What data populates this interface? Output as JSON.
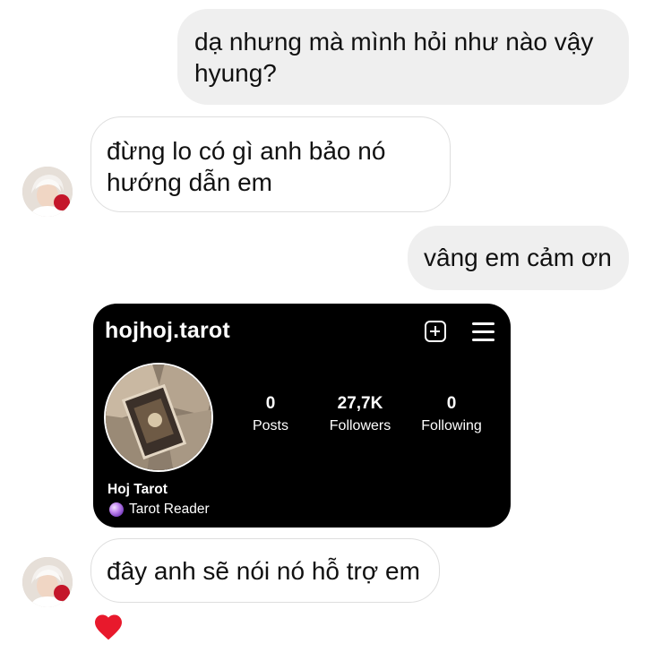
{
  "messages": [
    {
      "direction": "outgoing",
      "lines": [
        "dạ nhưng mà mình hỏi như nào vậy",
        "hyung?"
      ]
    },
    {
      "direction": "incoming",
      "lines": [
        "đừng lo có gì anh bảo nó",
        "hướng dẫn em"
      ]
    },
    {
      "direction": "outgoing",
      "lines": [
        "vâng em cảm ơn"
      ]
    },
    {
      "direction": "incoming",
      "lines": [
        "đây anh sẽ nói nó hỗ trợ em"
      ]
    }
  ],
  "shared_profile": {
    "username": "hojhoj.tarot",
    "stats": [
      {
        "value": "0",
        "label": "Posts"
      },
      {
        "value": "27,7K",
        "label": "Followers"
      },
      {
        "value": "0",
        "label": "Following"
      }
    ],
    "display_name": "Hoj Tarot",
    "bio": "Tarot Reader",
    "bio_icon": "crystal-ball-icon",
    "header_icons": [
      "new-post-icon",
      "menu-icon"
    ]
  },
  "reaction": {
    "icon": "heart-icon",
    "color": "#e8192c"
  },
  "colors": {
    "outgoing_bubble": "#efefef",
    "incoming_border": "#dedede",
    "card_background": "#000000"
  }
}
